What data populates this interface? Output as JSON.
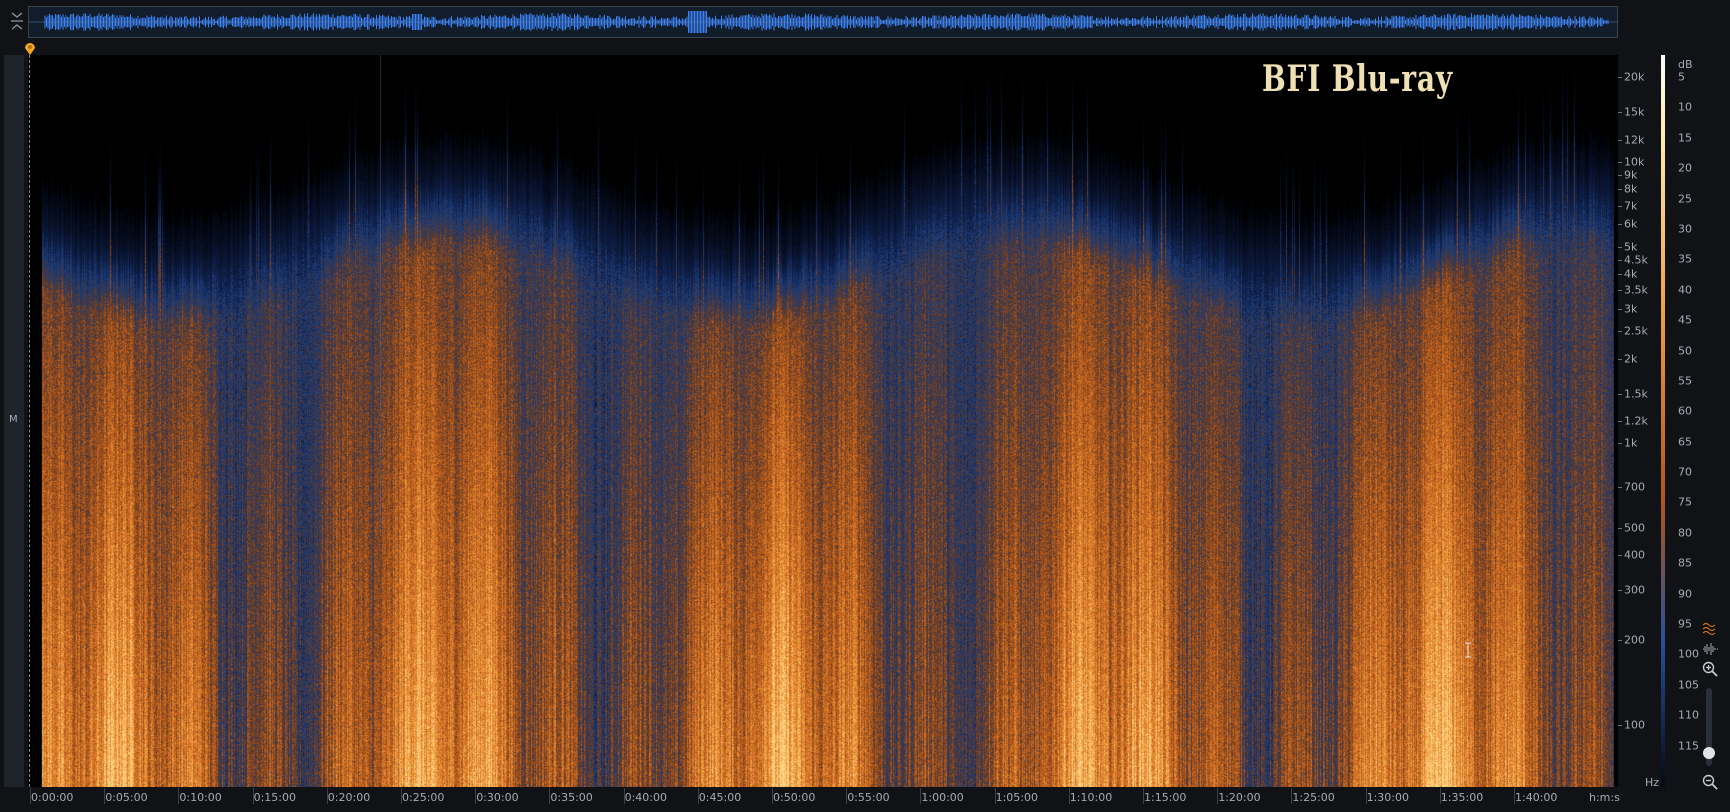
{
  "overview": {
    "waveform_color": "#3b82f6"
  },
  "channel": {
    "label": "M"
  },
  "watermark": {
    "text": "BFI  Blu-ray",
    "color": "#f0e1b4"
  },
  "frequency_axis": {
    "unit": "Hz",
    "ticks": [
      {
        "label": "20k",
        "hz": 20000
      },
      {
        "label": "15k",
        "hz": 15000
      },
      {
        "label": "12k",
        "hz": 12000
      },
      {
        "label": "10k",
        "hz": 10000
      },
      {
        "label": "9k",
        "hz": 9000
      },
      {
        "label": "8k",
        "hz": 8000
      },
      {
        "label": "7k",
        "hz": 7000
      },
      {
        "label": "6k",
        "hz": 6000
      },
      {
        "label": "5k",
        "hz": 5000
      },
      {
        "label": "4.5k",
        "hz": 4500
      },
      {
        "label": "4k",
        "hz": 4000
      },
      {
        "label": "3.5k",
        "hz": 3500
      },
      {
        "label": "3k",
        "hz": 3000
      },
      {
        "label": "2.5k",
        "hz": 2500
      },
      {
        "label": "2k",
        "hz": 2000
      },
      {
        "label": "1.5k",
        "hz": 1500
      },
      {
        "label": "1.2k",
        "hz": 1200
      },
      {
        "label": "1k",
        "hz": 1000
      },
      {
        "label": "700",
        "hz": 700
      },
      {
        "label": "500",
        "hz": 500
      },
      {
        "label": "400",
        "hz": 400
      },
      {
        "label": "300",
        "hz": 300
      },
      {
        "label": "200",
        "hz": 200
      },
      {
        "label": "100",
        "hz": 100
      }
    ]
  },
  "db_axis": {
    "unit": "dB",
    "ticks": [
      "5",
      "10",
      "15",
      "20",
      "25",
      "30",
      "35",
      "40",
      "45",
      "50",
      "55",
      "60",
      "65",
      "70",
      "75",
      "80",
      "85",
      "90",
      "95",
      "100",
      "105",
      "110",
      "115"
    ]
  },
  "time_axis": {
    "unit": "h:m:s",
    "ticks": [
      "0:00:00",
      "0:05:00",
      "0:10:00",
      "0:15:00",
      "0:20:00",
      "0:25:00",
      "0:30:00",
      "0:35:00",
      "0:40:00",
      "0:45:00",
      "0:50:00",
      "0:55:00",
      "1:00:00",
      "1:05:00",
      "1:10:00",
      "1:15:00",
      "1:20:00",
      "1:25:00",
      "1:30:00",
      "1:35:00",
      "1:40:00"
    ]
  },
  "colors": {
    "spectrum_low": "#0b1a3a",
    "spectrum_mid": "#1f4fa0",
    "spectrum_high": "#c2631a",
    "spectrum_peak": "#ffb24a",
    "playhead": "#f5a623"
  },
  "tools": [
    "spectrum-view-icon",
    "waveform-view-icon",
    "zoom-in-icon",
    "zoom-out-icon"
  ],
  "zoom": {
    "level": 0.1
  }
}
